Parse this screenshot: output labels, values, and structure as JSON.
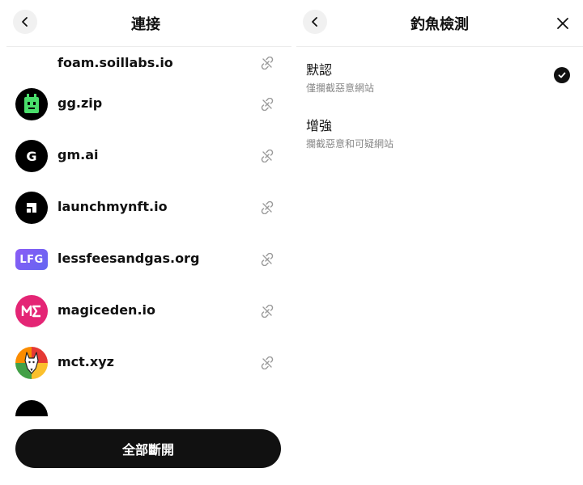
{
  "left": {
    "title": "連接",
    "sites": [
      {
        "name": "foam.soillabs.io",
        "icon": "foam-logo-icon"
      },
      {
        "name": "gg.zip",
        "icon": "gg-zip-logo-icon"
      },
      {
        "name": "gm.ai",
        "icon": "gm-ai-logo-icon",
        "letter": "G"
      },
      {
        "name": "launchmynft.io",
        "icon": "launchmynft-logo-icon"
      },
      {
        "name": "lessfeesandgas.org",
        "icon": "lfg-logo-icon",
        "logo_text": "LFG"
      },
      {
        "name": "magiceden.io",
        "icon": "magiceden-logo-icon"
      },
      {
        "name": "mct.xyz",
        "icon": "mct-logo-icon"
      }
    ],
    "disconnect_all": "全部斷開"
  },
  "right": {
    "title": "釣魚檢測",
    "options": [
      {
        "label": "默認",
        "desc": "僅攔截惡意網站",
        "selected": true
      },
      {
        "label": "增強",
        "desc": "攔截惡意和可疑網站",
        "selected": false
      }
    ]
  },
  "colors": {
    "primary": "#111111",
    "gg_green": "#4ADE6B",
    "magiceden_pink": "#E42575",
    "lfg_purple": "#8B5CF6",
    "muted_text": "#888888"
  }
}
